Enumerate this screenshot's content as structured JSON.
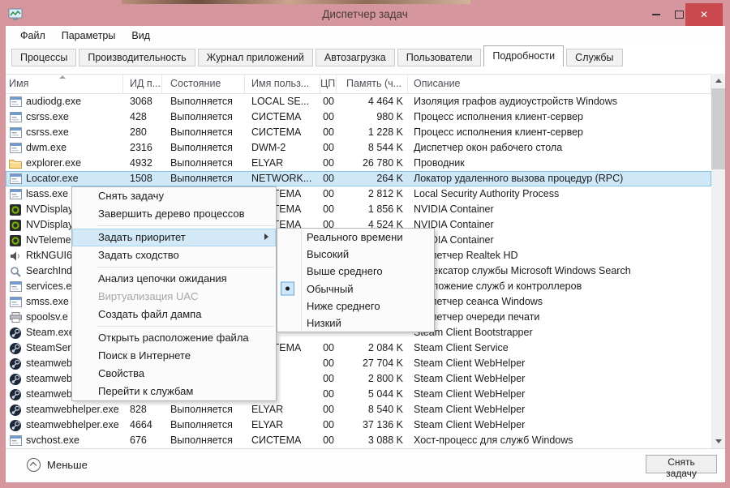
{
  "window": {
    "title": "Диспетчер задач"
  },
  "menubar": {
    "items": [
      "Файл",
      "Параметры",
      "Вид"
    ]
  },
  "tabs": {
    "items": [
      "Процессы",
      "Производительность",
      "Журнал приложений",
      "Автозагрузка",
      "Пользователи",
      "Подробности",
      "Службы"
    ],
    "active_index": 5
  },
  "table": {
    "columns": [
      "Имя",
      "ИД п...",
      "Состояние",
      "Имя польз...",
      "ЦП",
      "Память (ч...",
      "Описание"
    ],
    "sort_column": "Имя",
    "sort_direction": "asc",
    "rows": [
      {
        "icon": "app",
        "name": "audiodg.exe",
        "pid": "3068",
        "status": "Выполняется",
        "user": "LOCAL SE...",
        "cpu": "00",
        "mem": "4 464 K",
        "desc": "Изоляция графов аудиоустройств Windows",
        "selected": false
      },
      {
        "icon": "app",
        "name": "csrss.exe",
        "pid": "428",
        "status": "Выполняется",
        "user": "СИСТЕМА",
        "cpu": "00",
        "mem": "980 K",
        "desc": "Процесс исполнения клиент-сервер",
        "selected": false
      },
      {
        "icon": "app",
        "name": "csrss.exe",
        "pid": "280",
        "status": "Выполняется",
        "user": "СИСТЕМА",
        "cpu": "00",
        "mem": "1 228 K",
        "desc": "Процесс исполнения клиент-сервер",
        "selected": false
      },
      {
        "icon": "app",
        "name": "dwm.exe",
        "pid": "2316",
        "status": "Выполняется",
        "user": "DWM-2",
        "cpu": "00",
        "mem": "8 544 K",
        "desc": "Диспетчер окон рабочего стола",
        "selected": false
      },
      {
        "icon": "folder",
        "name": "explorer.exe",
        "pid": "4932",
        "status": "Выполняется",
        "user": "ELYAR",
        "cpu": "00",
        "mem": "26 780 K",
        "desc": "Проводник",
        "selected": false
      },
      {
        "icon": "app",
        "name": "Locator.exe",
        "pid": "1508",
        "status": "Выполняется",
        "user": "NETWORK...",
        "cpu": "00",
        "mem": "264 K",
        "desc": "Локатор удаленного вызова процедур (RPC)",
        "selected": true
      },
      {
        "icon": "app",
        "name": "lsass.exe",
        "pid": "",
        "status": "",
        "user": "СИСТЕМА",
        "cpu": "00",
        "mem": "2 812 K",
        "desc": "Local Security Authority Process",
        "selected": false
      },
      {
        "icon": "nvidia",
        "name": "NVDisplay",
        "pid": "",
        "status": "",
        "user": "СИСТЕМА",
        "cpu": "00",
        "mem": "1 856 K",
        "desc": "NVIDIA Container",
        "selected": false
      },
      {
        "icon": "nvidia",
        "name": "NVDisplay",
        "pid": "",
        "status": "",
        "user": "СИСТЕМА",
        "cpu": "00",
        "mem": "4 524 K",
        "desc": "NVIDIA Container",
        "selected": false
      },
      {
        "icon": "nvidia",
        "name": "NvTeleme",
        "pid": "",
        "status": "",
        "user": "",
        "cpu": "",
        "mem": "",
        "desc": "NVIDIA Container",
        "selected": false
      },
      {
        "icon": "speaker",
        "name": "RtkNGUI6",
        "pid": "",
        "status": "",
        "user": "",
        "cpu": "",
        "mem": "",
        "desc": "Диспетчер Realtek HD",
        "selected": false
      },
      {
        "icon": "search",
        "name": "SearchInd",
        "pid": "",
        "status": "",
        "user": "",
        "cpu": "",
        "mem": "",
        "desc": "Индексатор службы Microsoft Windows Search",
        "selected": false
      },
      {
        "icon": "app",
        "name": "services.e",
        "pid": "",
        "status": "",
        "user": "",
        "cpu": "",
        "mem": "",
        "desc": "Приложение служб и контроллеров",
        "selected": false
      },
      {
        "icon": "app",
        "name": "smss.exe",
        "pid": "",
        "status": "",
        "user": "",
        "cpu": "",
        "mem": "",
        "desc": "Диспетчер сеанса  Windows",
        "selected": false
      },
      {
        "icon": "printer",
        "name": "spoolsv.e",
        "pid": "",
        "status": "",
        "user": "",
        "cpu": "",
        "mem": "",
        "desc": "Диспетчер очереди печати",
        "selected": false
      },
      {
        "icon": "steam",
        "name": "Steam.exe",
        "pid": "",
        "status": "",
        "user": "",
        "cpu": "",
        "mem": "",
        "desc": "Steam Client Bootstrapper",
        "selected": false
      },
      {
        "icon": "steam",
        "name": "SteamSer",
        "pid": "",
        "status": "",
        "user": "СИСТЕМА",
        "cpu": "00",
        "mem": "2 084 K",
        "desc": "Steam Client Service",
        "selected": false
      },
      {
        "icon": "steam",
        "name": "steamweb",
        "pid": "",
        "status": "",
        "user": "",
        "cpu": "00",
        "mem": "27 704 K",
        "desc": "Steam Client WebHelper",
        "selected": false
      },
      {
        "icon": "steam",
        "name": "steamweb",
        "pid": "",
        "status": "",
        "user": "",
        "cpu": "00",
        "mem": "2 800 K",
        "desc": "Steam Client WebHelper",
        "selected": false
      },
      {
        "icon": "steam",
        "name": "steamweb",
        "pid": "",
        "status": "",
        "user": "",
        "cpu": "00",
        "mem": "5 044 K",
        "desc": "Steam Client WebHelper",
        "selected": false
      },
      {
        "icon": "steam",
        "name": "steamwebhelper.exe",
        "pid": "828",
        "status": "Выполняется",
        "user": "ELYAR",
        "cpu": "00",
        "mem": "8 540 K",
        "desc": "Steam Client WebHelper",
        "selected": false
      },
      {
        "icon": "steam",
        "name": "steamwebhelper.exe",
        "pid": "4664",
        "status": "Выполняется",
        "user": "ELYAR",
        "cpu": "00",
        "mem": "37 136 K",
        "desc": "Steam Client WebHelper",
        "selected": false
      },
      {
        "icon": "app",
        "name": "svchost.exe",
        "pid": "676",
        "status": "Выполняется",
        "user": "СИСТЕМА",
        "cpu": "00",
        "mem": "3 088 K",
        "desc": "Хост-процесс для служб Windows",
        "selected": false
      }
    ]
  },
  "context_menu": {
    "items": [
      {
        "type": "item",
        "label": "Снять задачу"
      },
      {
        "type": "item",
        "label": "Завершить дерево процессов"
      },
      {
        "type": "separator"
      },
      {
        "type": "item",
        "label": "Задать приоритет",
        "highlighted": true,
        "has_submenu": true
      },
      {
        "type": "item",
        "label": "Задать сходство"
      },
      {
        "type": "separator"
      },
      {
        "type": "item",
        "label": "Анализ цепочки ожидания"
      },
      {
        "type": "item",
        "label": "Виртуализация UAC",
        "disabled": true
      },
      {
        "type": "item",
        "label": "Создать файл дампа"
      },
      {
        "type": "separator"
      },
      {
        "type": "item",
        "label": "Открыть расположение файла"
      },
      {
        "type": "item",
        "label": "Поиск в Интернете"
      },
      {
        "type": "item",
        "label": "Свойства"
      },
      {
        "type": "item",
        "label": "Перейти к службам"
      }
    ]
  },
  "priority_submenu": {
    "items": [
      {
        "label": "Реального времени",
        "selected": false
      },
      {
        "label": "Высокий",
        "selected": false
      },
      {
        "label": "Выше среднего",
        "selected": false
      },
      {
        "label": "Обычный",
        "selected": true
      },
      {
        "label": "Ниже среднего",
        "selected": false
      },
      {
        "label": "Низкий",
        "selected": false
      }
    ]
  },
  "footer": {
    "less_label": "Меньше",
    "end_task_label": "Снять задачу"
  },
  "colors": {
    "titlebar": "#d6969d",
    "close_button": "#c9494f",
    "selection_fill": "#cfe8f8",
    "selection_border": "#86c4e7",
    "menu_highlight": "#d4e9f8",
    "menu_highlight_border": "#a9d4ef",
    "nvidia_green": "#76b900",
    "steam_navy": "#1b2838"
  }
}
